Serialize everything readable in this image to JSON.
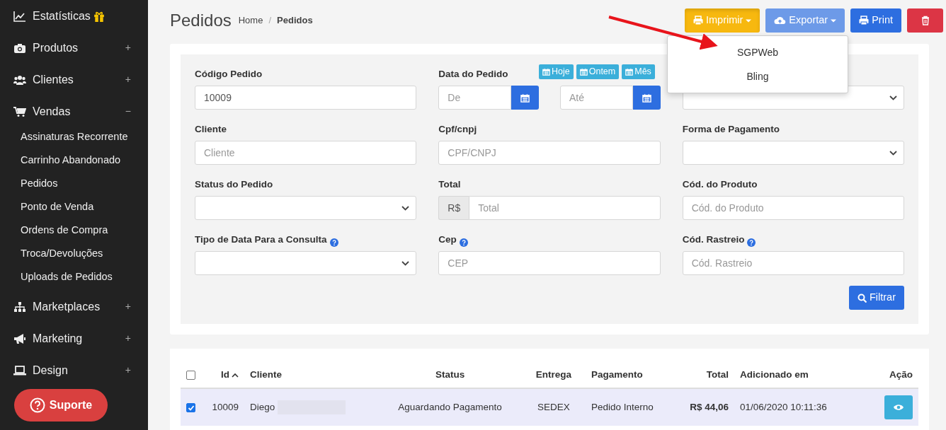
{
  "sidebar": {
    "items": [
      {
        "label": "Estatísticas",
        "gift": true
      },
      {
        "label": "Produtos",
        "toggle": "+"
      },
      {
        "label": "Clientes",
        "toggle": "+"
      },
      {
        "label": "Vendas",
        "toggle": "−",
        "children": [
          {
            "label": "Assinaturas Recorrente"
          },
          {
            "label": "Carrinho Abandonado"
          },
          {
            "label": "Pedidos"
          },
          {
            "label": "Ponto de Venda"
          },
          {
            "label": "Ordens de Compra"
          },
          {
            "label": "Troca/Devoluções"
          },
          {
            "label": "Uploads de Pedidos"
          }
        ]
      },
      {
        "label": "Marketplaces",
        "toggle": "+"
      },
      {
        "label": "Marketing",
        "toggle": "+"
      },
      {
        "label": "Design",
        "toggle": "+"
      }
    ]
  },
  "support_button": {
    "label": "Suporte"
  },
  "header": {
    "title": "Pedidos",
    "breadcrumb": [
      "Home",
      "Pedidos"
    ],
    "breadcrumb_separator": "/"
  },
  "toolbar": [
    {
      "kind": "print-menu",
      "label": "Imprimir",
      "expanded": true,
      "menu": [
        "SGPWeb",
        "Bling"
      ]
    },
    {
      "kind": "export",
      "label": "Exportar",
      "expanded": false
    },
    {
      "kind": "print",
      "label": "Print"
    },
    {
      "kind": "delete"
    }
  ],
  "date_shortcuts": [
    "Hoje",
    "Ontem",
    "Mês"
  ],
  "filters": [
    {
      "kind": "text",
      "label": "Código Pedido",
      "value": "10009"
    },
    {
      "kind": "date-range",
      "label": "Data do Pedido",
      "placeholders": [
        "De",
        "Até"
      ]
    },
    {
      "kind": "select"
    },
    {
      "kind": "text",
      "label": "Cliente",
      "placeholder": "Cliente"
    },
    {
      "kind": "text",
      "label": "Cpf/cnpj",
      "placeholder": "CPF/CNPJ"
    },
    {
      "kind": "select",
      "label": "Forma de Pagamento"
    },
    {
      "kind": "select",
      "label": "Status do Pedido"
    },
    {
      "kind": "addon",
      "label": "Total",
      "addon": "R$",
      "placeholder": "Total"
    },
    {
      "kind": "text",
      "label": "Cód. do Produto",
      "placeholder": "Cód. do Produto"
    },
    {
      "kind": "select",
      "label": "Tipo de Data Para a Consulta",
      "help": true
    },
    {
      "kind": "text",
      "label": "Cep",
      "placeholder": "CEP",
      "help": true
    },
    {
      "kind": "text",
      "label": "Cód. Rastreio",
      "placeholder": "Cód. Rastreio",
      "help": true
    }
  ],
  "filter_button": {
    "label": "Filtrar"
  },
  "table": {
    "select_all_checked": false,
    "columns": [
      {
        "label": "Id",
        "sorted": true
      },
      {
        "label": "Cliente",
        "sorted": false
      },
      {
        "label": "Status",
        "sorted": false
      },
      {
        "label": "Entrega",
        "sorted": false
      },
      {
        "label": "Pagamento",
        "sorted": false
      },
      {
        "label": "Total",
        "sorted": false
      },
      {
        "label": "Adicionado em",
        "sorted": false
      },
      {
        "label": "Ação",
        "sorted": false
      }
    ],
    "rows": [
      {
        "checked": true,
        "selected": true,
        "id": "10009",
        "cliente": "Diego",
        "status": "Aguardando Pagamento",
        "entrega": "SEDEX",
        "pagamento": "Pedido Interno",
        "total": "R$ 44,06",
        "adicionado": "01/06/2020 10:11:36"
      }
    ]
  }
}
